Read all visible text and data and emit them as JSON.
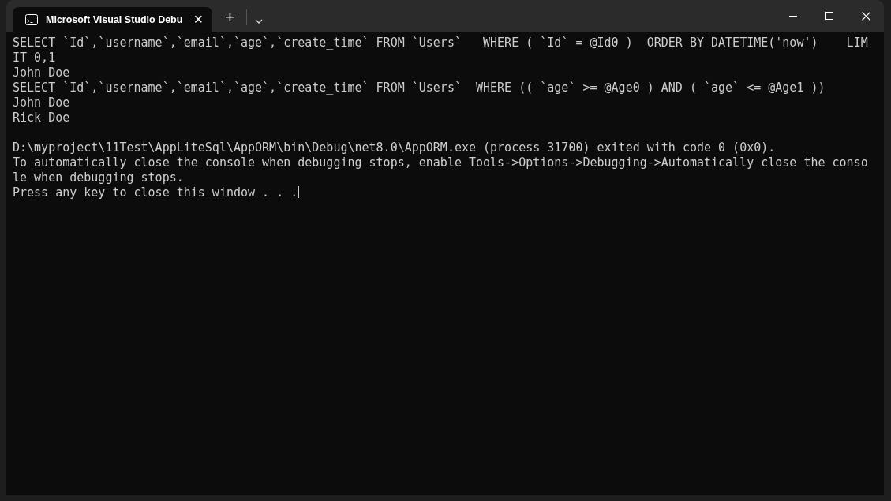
{
  "window": {
    "tab_title": "Microsoft Visual Studio Debu",
    "tab_close": "×",
    "new_tab": "+"
  },
  "console": {
    "blocks": [
      [
        "SELECT `Id`,`username`,`email`,`age`,`create_time` FROM `Users`   WHERE ( `Id` = @Id0 )  ORDER BY DATETIME('now')    LIM",
        "IT 0,1",
        "John Doe",
        "SELECT `Id`,`username`,`email`,`age`,`create_time` FROM `Users`  WHERE (( `age` >= @Age0 ) AND ( `age` <= @Age1 ))",
        "John Doe",
        "Rick Doe"
      ],
      [
        "D:\\myproject\\11Test\\AppLiteSql\\AppORM\\bin\\Debug\\net8.0\\AppORM.exe (process 31700) exited with code 0 (0x0).",
        "To automatically close the console when debugging stops, enable Tools->Options->Debugging->Automatically close the conso",
        "le when debugging stops.",
        "Press any key to close this window . . ."
      ]
    ]
  }
}
